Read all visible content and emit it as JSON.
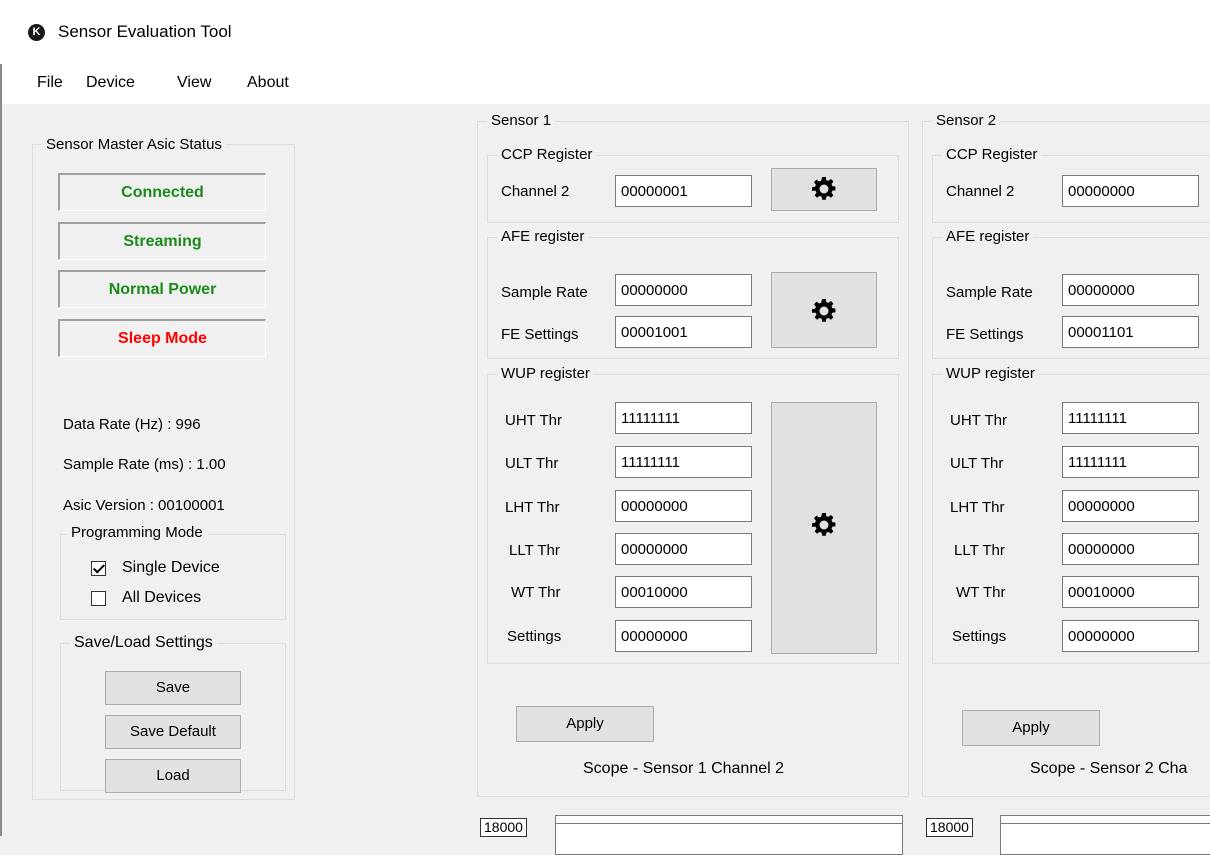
{
  "app": {
    "title": "Sensor Evaluation Tool",
    "icon": "app-logo-icon"
  },
  "menu": {
    "file": "File",
    "device": "Device",
    "view": "View",
    "about": "About"
  },
  "status": {
    "title": "Sensor Master Asic Status",
    "connected": "Connected",
    "streaming": "Streaming",
    "normal_power": "Normal Power",
    "sleep_mode": "Sleep Mode",
    "colors": {
      "active": "#1b8a1b",
      "alert": "#ff0000"
    }
  },
  "info": {
    "data_rate": "Data Rate (Hz) : 996",
    "sample_rate": "Sample Rate (ms) : 1.00",
    "asic_version": "Asic Version : 00100001"
  },
  "programming": {
    "title": "Programming Mode",
    "single_device": {
      "label": "Single Device",
      "checked": true
    },
    "all_devices": {
      "label": "All Devices",
      "checked": false
    }
  },
  "settings": {
    "title": "Save/Load Settings",
    "save": "Save",
    "save_default": "Save Default",
    "load": "Load"
  },
  "sensor1": {
    "title": "Sensor 1",
    "ccp_title": "CCP Register",
    "channel_label": "Channel 2",
    "channel_value": "00000001",
    "afe_title": "AFE register",
    "sample_rate_label": "Sample Rate",
    "sample_rate_value": "00000000",
    "fe_settings_label": "FE Settings",
    "fe_settings_value": "00001001",
    "wup_title": "WUP register",
    "uht_label": "UHT Thr",
    "uht_value": "11111111",
    "ult_label": "ULT Thr",
    "ult_value": "11111111",
    "lht_label": "LHT Thr",
    "lht_value": "00000000",
    "llt_label": "LLT Thr",
    "llt_value": "00000000",
    "wt_label": "WT Thr",
    "wt_value": "00010000",
    "settings_label": "Settings",
    "settings_value": "00000000",
    "apply": "Apply",
    "scope": "Scope - Sensor 1 Channel 2",
    "scope_value": "18000"
  },
  "sensor2": {
    "title": "Sensor 2",
    "ccp_title": "CCP Register",
    "channel_label": "Channel 2",
    "channel_value": "00000000",
    "afe_title": "AFE register",
    "sample_rate_label": "Sample Rate",
    "sample_rate_value": "00000000",
    "fe_settings_label": "FE Settings",
    "fe_settings_value": "00001101",
    "wup_title": "WUP register",
    "uht_label": "UHT Thr",
    "uht_value": "11111111",
    "ult_label": "ULT Thr",
    "ult_value": "11111111",
    "lht_label": "LHT Thr",
    "lht_value": "00000000",
    "llt_label": "LLT Thr",
    "llt_value": "00000000",
    "wt_label": "WT Thr",
    "wt_value": "00010000",
    "settings_label": "Settings",
    "settings_value": "00000000",
    "apply": "Apply",
    "scope": "Scope - Sensor 2 Cha",
    "scope_value": "18000"
  }
}
